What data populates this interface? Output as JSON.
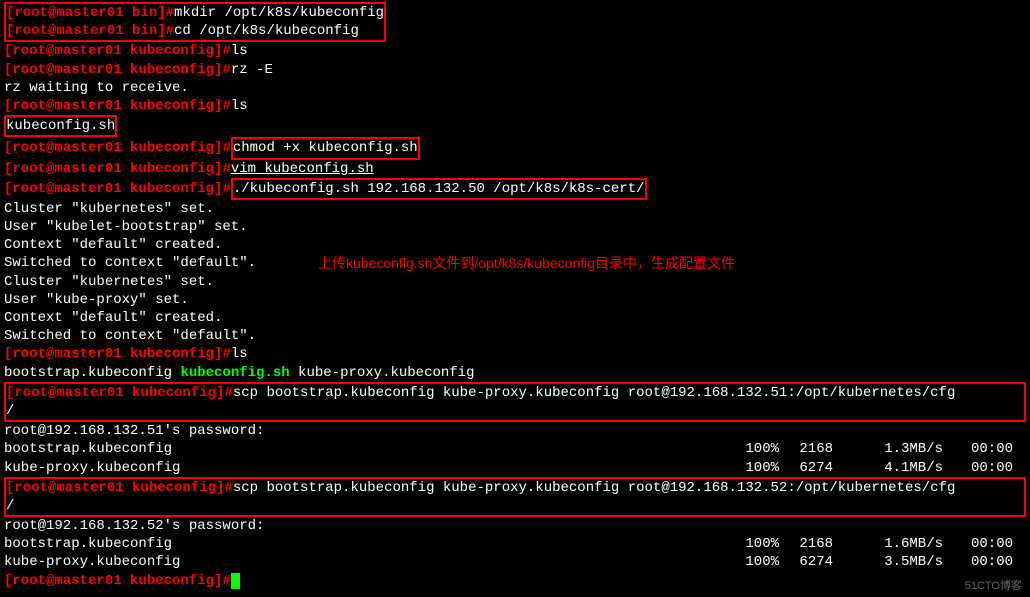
{
  "lines": {
    "l1_prompt": "[root@master01 bin]#",
    "l1_cmd": "mkdir /opt/k8s/kubeconfig",
    "l2_prompt": "[root@master01 bin]#",
    "l2_cmd": "cd /opt/k8s/kubeconfig",
    "l3_prompt": "[root@master01 kubeconfig]#",
    "l3_cmd": "ls",
    "l4_prompt": "[root@master01 kubeconfig]#",
    "l4_cmd": "rz -E",
    "l5": "rz waiting to receive.",
    "l6_prompt": "[root@master01 kubeconfig]#",
    "l6_cmd": "ls",
    "l7": "kubeconfig.sh",
    "l8_prompt": "[root@master01 kubeconfig]#",
    "l8_cmd": "chmod +x kubeconfig.sh",
    "l9_prompt": "[root@master01 kubeconfig]#",
    "l9_cmd": "vim kubeconfig.sh",
    "l10_prompt": "[root@master01 kubeconfig]#",
    "l10_cmd": "./kubeconfig.sh 192.168.132.50 /opt/k8s/k8s-cert/",
    "l11": "Cluster \"kubernetes\" set.",
    "l12": "User \"kubelet-bootstrap\" set.",
    "l13": "Context \"default\" created.",
    "l14": "Switched to context \"default\".",
    "l15": "Cluster \"kubernetes\" set.",
    "l16": "User \"kube-proxy\" set.",
    "l17": "Context \"default\" created.",
    "l18": "Switched to context \"default\".",
    "l19_prompt": "[root@master01 kubeconfig]#",
    "l19_cmd": "ls",
    "l20a": "bootstrap.kubeconfig  ",
    "l20b": "kubeconfig.sh",
    "l20c": "  kube-proxy.kubeconfig",
    "l21_prompt": "[root@master01 kubeconfig]#",
    "l21_cmd": "scp bootstrap.kubeconfig kube-proxy.kubeconfig root@192.168.132.51:/opt/kubernetes/cfg",
    "l21b": "/",
    "l22": "root@192.168.132.51's password:",
    "t1_file": "bootstrap.kubeconfig",
    "t1_pct": "100%",
    "t1_size": "2168",
    "t1_speed": "1.3MB/s",
    "t1_time": "00:00",
    "t2_file": "kube-proxy.kubeconfig",
    "t2_pct": "100%",
    "t2_size": "6274",
    "t2_speed": "4.1MB/s",
    "t2_time": "00:00",
    "l25_prompt": "[root@master01 kubeconfig]#",
    "l25_cmd": "scp bootstrap.kubeconfig kube-proxy.kubeconfig root@192.168.132.52:/opt/kubernetes/cfg",
    "l25b": "/",
    "l26": "root@192.168.132.52's password:",
    "t3_file": "bootstrap.kubeconfig",
    "t3_pct": "100%",
    "t3_size": "2168",
    "t3_speed": "1.6MB/s",
    "t3_time": "00:00",
    "t4_file": "kube-proxy.kubeconfig",
    "t4_pct": "100%",
    "t4_size": "6274",
    "t4_speed": "3.5MB/s",
    "t4_time": "00:00",
    "l29_prompt": "[root@master01 kubeconfig]#"
  },
  "annotation": "上传kubeconfig.sh文件到/opt/k8s/kubeconfig目录中，生成配置文件",
  "watermark": "51CTO博客"
}
